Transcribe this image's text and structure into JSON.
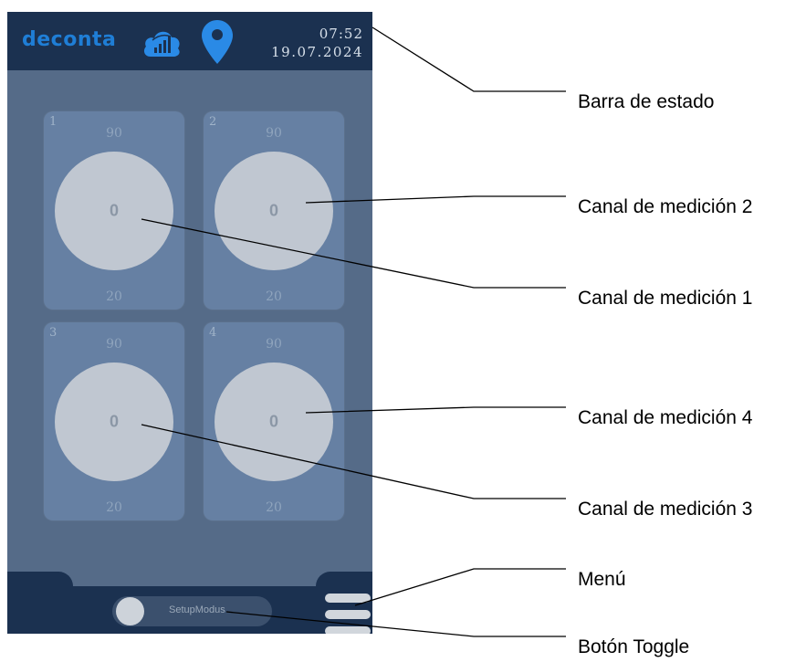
{
  "status_bar": {
    "logo": "deconta",
    "time": "07:52",
    "date": "19.07.2024",
    "icons": [
      "cloud-signal-icon",
      "location-pin-icon"
    ],
    "bg_color": "#1b3150",
    "accent_color": "#1f7ed6"
  },
  "channels": [
    {
      "number": "1",
      "max": "90",
      "value": "0",
      "min": "20"
    },
    {
      "number": "2",
      "max": "90",
      "value": "0",
      "min": "20"
    },
    {
      "number": "3",
      "max": "90",
      "value": "0",
      "min": "20"
    },
    {
      "number": "4",
      "max": "90",
      "value": "0",
      "min": "20"
    }
  ],
  "bottom_bar": {
    "toggle_label": "SetupModus",
    "menu_icon": "hamburger-menu-icon"
  },
  "annotations": {
    "status_bar": "Barra de estado",
    "channel_2": "Canal de medición 2",
    "channel_1": "Canal de medición 1",
    "channel_4": "Canal de medición 4",
    "channel_3": "Canal de medición 3",
    "menu": "Menú",
    "toggle": "Botón Toggle"
  }
}
